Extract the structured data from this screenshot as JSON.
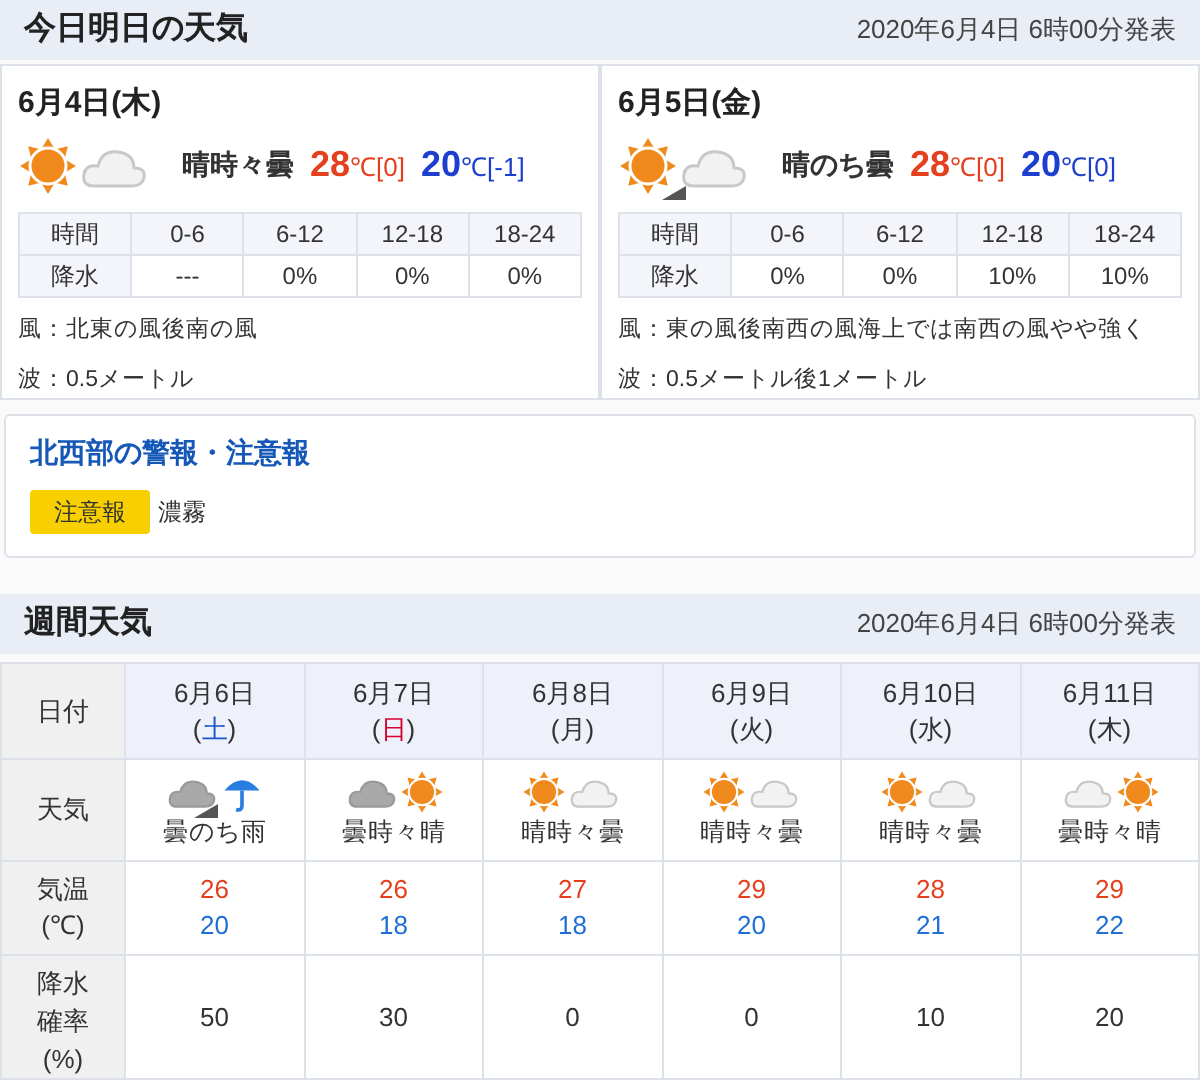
{
  "today_section": {
    "title": "今日明日の天気",
    "issued": "2020年6月4日 6時00分発表",
    "days": [
      {
        "date": "6月4日(木)",
        "weather": {
          "parts": [
            {
              "kind": "sun"
            },
            {
              "kind": "cloud"
            }
          ],
          "arrow": false
        },
        "summary": "晴時々曇",
        "high": {
          "value": "28",
          "suffix": "℃[0]"
        },
        "low": {
          "value": "20",
          "suffix": "℃[-1]"
        },
        "time_header": "時間",
        "periods": [
          "0-6",
          "6-12",
          "12-18",
          "18-24"
        ],
        "precip_label": "降水",
        "precip": [
          "---",
          "0%",
          "0%",
          "0%"
        ],
        "wind": "風：北東の風後南の風",
        "wave": "波：0.5メートル"
      },
      {
        "date": "6月5日(金)",
        "weather": {
          "parts": [
            {
              "kind": "sun"
            },
            {
              "kind": "cloud"
            }
          ],
          "arrow": true
        },
        "summary": "晴のち曇",
        "high": {
          "value": "28",
          "suffix": "℃[0]"
        },
        "low": {
          "value": "20",
          "suffix": "℃[0]"
        },
        "time_header": "時間",
        "periods": [
          "0-6",
          "6-12",
          "12-18",
          "18-24"
        ],
        "precip_label": "降水",
        "precip": [
          "0%",
          "0%",
          "10%",
          "10%"
        ],
        "wind": "風：東の風後南西の風海上では南西の風やや強く",
        "wave": "波：0.5メートル後1メートル"
      }
    ]
  },
  "warnings": {
    "title": "北西部の警報・注意報",
    "items": [
      {
        "badge": "注意報",
        "color": "#f8d000",
        "text": "濃霧"
      }
    ]
  },
  "weekly_section": {
    "title": "週間天気",
    "issued": "2020年6月4日 6時00分発表",
    "row_labels": {
      "date": [
        "日付"
      ],
      "weather": [
        "天気"
      ],
      "temp": [
        "気温",
        "(℃)"
      ],
      "precip": [
        "降水",
        "確率",
        "(%)"
      ]
    },
    "days": [
      {
        "date": "6月6日",
        "weekday": "(",
        "weekday_name": "土",
        "weekday_close": ")",
        "color": "#1a56c8",
        "weather": {
          "parts": [
            {
              "kind": "overcast"
            },
            {
              "kind": "umbrella"
            }
          ],
          "arrow": true
        },
        "summary": "曇のち雨",
        "high": "26",
        "low": "20",
        "precip": "50"
      },
      {
        "date": "6月7日",
        "weekday": "(",
        "weekday_name": "日",
        "weekday_close": ")",
        "color": "#d7002e",
        "weather": {
          "parts": [
            {
              "kind": "overcast"
            },
            {
              "kind": "sun"
            }
          ],
          "arrow": false
        },
        "summary": "曇時々晴",
        "high": "26",
        "low": "18",
        "precip": "30"
      },
      {
        "date": "6月8日",
        "weekday": "(",
        "weekday_name": "月",
        "weekday_close": ")",
        "color": "#333333",
        "weather": {
          "parts": [
            {
              "kind": "sun"
            },
            {
              "kind": "cloud"
            }
          ],
          "arrow": false
        },
        "summary": "晴時々曇",
        "high": "27",
        "low": "18",
        "precip": "0"
      },
      {
        "date": "6月9日",
        "weekday": "(",
        "weekday_name": "火",
        "weekday_close": ")",
        "color": "#333333",
        "weather": {
          "parts": [
            {
              "kind": "sun"
            },
            {
              "kind": "cloud"
            }
          ],
          "arrow": false
        },
        "summary": "晴時々曇",
        "high": "29",
        "low": "20",
        "precip": "0"
      },
      {
        "date": "6月10日",
        "weekday": "(",
        "weekday_name": "水",
        "weekday_close": ")",
        "color": "#333333",
        "weather": {
          "parts": [
            {
              "kind": "sun"
            },
            {
              "kind": "cloud"
            }
          ],
          "arrow": false
        },
        "summary": "晴時々曇",
        "high": "28",
        "low": "21",
        "precip": "10"
      },
      {
        "date": "6月11日",
        "weekday": "(",
        "weekday_name": "木",
        "weekday_close": ")",
        "color": "#333333",
        "weather": {
          "parts": [
            {
              "kind": "cloud"
            },
            {
              "kind": "sun"
            }
          ],
          "arrow": false
        },
        "summary": "曇時々晴",
        "high": "29",
        "low": "22",
        "precip": "20"
      }
    ]
  }
}
